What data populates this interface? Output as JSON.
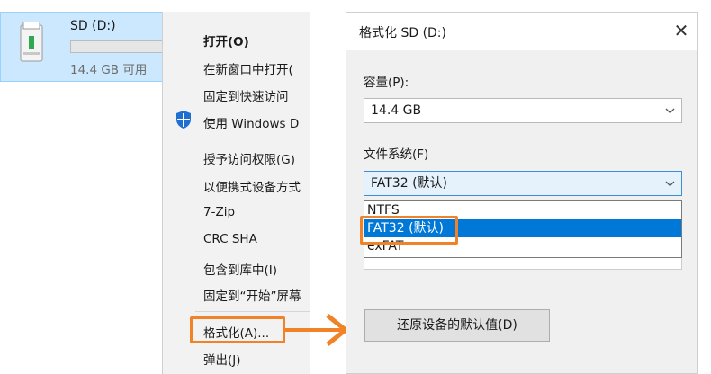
{
  "explorer": {
    "drive_name": "SD (D:)",
    "drive_free": "14.4 GB 可用"
  },
  "context_menu": {
    "items": [
      {
        "label": "打开(O)"
      },
      {
        "label": "在新窗口中打开("
      },
      {
        "label": "固定到快速访问"
      },
      {
        "label": "使用 Windows D"
      },
      {
        "label": "授予访问权限(G)"
      },
      {
        "label": "以便携式设备方式"
      },
      {
        "label": "7-Zip"
      },
      {
        "label": "CRC SHA"
      },
      {
        "label": "包含到库中(I)"
      },
      {
        "label": "固定到“开始”屏幕"
      },
      {
        "label": "格式化(A)..."
      },
      {
        "label": "弹出(J)"
      }
    ]
  },
  "dialog": {
    "title": "格式化 SD (D:)",
    "close_glyph": "✕",
    "capacity_label": "容量(P):",
    "capacity_value": "14.4 GB",
    "filesystem_label": "文件系统(F)",
    "filesystem_value": "FAT32 (默认)",
    "filesystem_options": [
      "NTFS",
      "FAT32 (默认)",
      "exFAT"
    ],
    "restore_button": "还原设备的默认值(D)"
  },
  "colors": {
    "highlight": "#f08228",
    "selection": "#0078d7",
    "drive_tile": "#cce8ff"
  },
  "icons": {
    "drive": "usb-drive-icon",
    "shield": "windows-defender-shield-icon",
    "chevron": "chevron-down-icon",
    "arrow": "arrow-right-icon"
  }
}
